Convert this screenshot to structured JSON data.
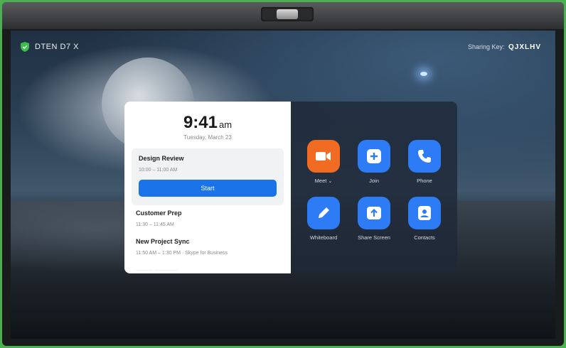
{
  "device": {
    "name": "DTEN D7 X"
  },
  "sharing": {
    "label": "Sharing Key:",
    "key": "QJXLHV"
  },
  "clock": {
    "time": "9:41",
    "ampm": "am",
    "date": "Tuesday, March 23"
  },
  "meetings": [
    {
      "title": "Design Review",
      "time": "10:00 – 11:00 AM",
      "action": "Start"
    },
    {
      "title": "Customer Prep",
      "time": "11:30 – 11:45 AM"
    },
    {
      "title": "New Project Sync",
      "time": "11:50 AM – 1:30 PM · Skype for Business"
    }
  ],
  "actions": [
    {
      "label": "Meet",
      "icon": "video-camera-icon",
      "color": "#f26b22"
    },
    {
      "label": "Join",
      "icon": "plus-icon",
      "color": "#2d7cf6"
    },
    {
      "label": "Phone",
      "icon": "phone-icon",
      "color": "#2d7cf6"
    },
    {
      "label": "Whiteboard",
      "icon": "pencil-icon",
      "color": "#2d7cf6"
    },
    {
      "label": "Share Screen",
      "icon": "upload-icon",
      "color": "#2d7cf6"
    },
    {
      "label": "Contacts",
      "icon": "contact-card-icon",
      "color": "#2d7cf6"
    }
  ]
}
